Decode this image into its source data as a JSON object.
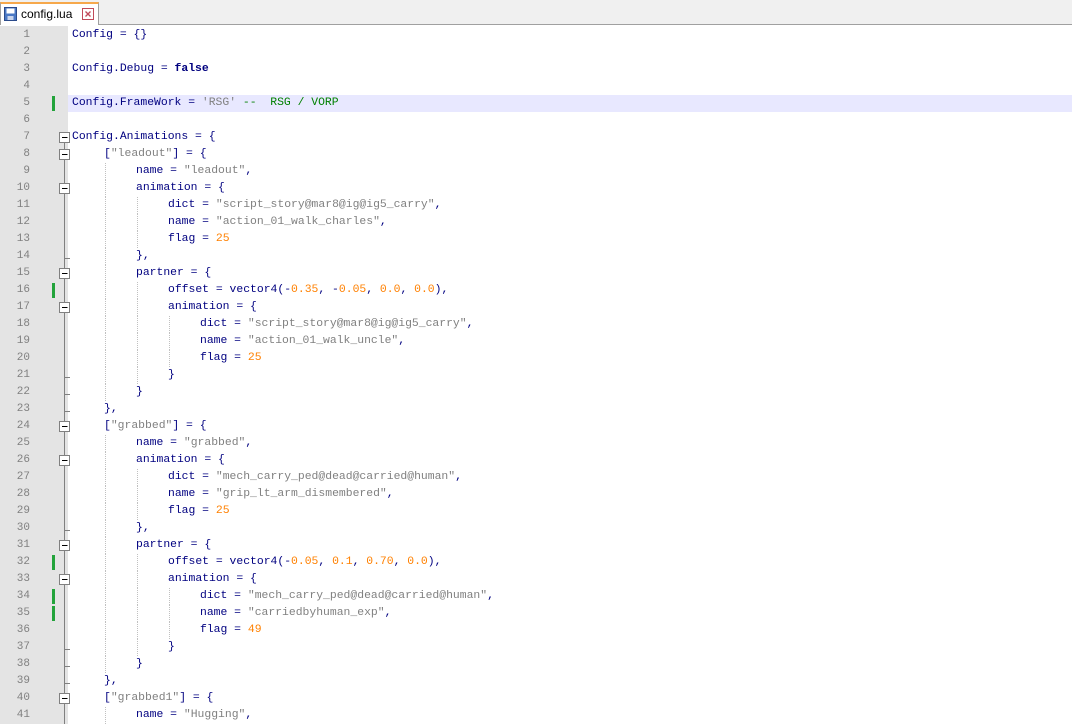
{
  "tab": {
    "filename": "config.lua",
    "icon": "save-file-icon",
    "close_icon": "close-icon"
  },
  "colors": {
    "string": "#808080",
    "number": "#ff8000",
    "keyword": "#00007f",
    "comment": "#008000",
    "default": "#000080",
    "change_bar": "#23a33b",
    "highlight": "#e8e8ff"
  },
  "highlighted_line": 5,
  "changed_lines": [
    5,
    16,
    32,
    34,
    35
  ],
  "lines": [
    {
      "n": "1",
      "indent": 0,
      "tokens": [
        [
          "op",
          "Config = {}"
        ]
      ]
    },
    {
      "n": "2",
      "indent": 0,
      "tokens": []
    },
    {
      "n": "3",
      "indent": 0,
      "tokens": [
        [
          "op",
          "Config.Debug = "
        ],
        [
          "kw",
          "false"
        ]
      ]
    },
    {
      "n": "4",
      "indent": 0,
      "tokens": []
    },
    {
      "n": "5",
      "indent": 0,
      "tokens": [
        [
          "op",
          "Config.FrameWork = "
        ],
        [
          "str",
          "'RSG'"
        ],
        [
          "op",
          " "
        ],
        [
          "cmt",
          "--  RSG / VORP"
        ]
      ]
    },
    {
      "n": "6",
      "indent": 0,
      "tokens": []
    },
    {
      "n": "7",
      "indent": 0,
      "fold": "open",
      "tokens": [
        [
          "op",
          "Config.Animations = {"
        ]
      ]
    },
    {
      "n": "8",
      "indent": 1,
      "fold": "open",
      "tokens": [
        [
          "op",
          "["
        ],
        [
          "str",
          "\"leadout\""
        ],
        [
          "op",
          "] = {"
        ]
      ]
    },
    {
      "n": "9",
      "indent": 2,
      "tokens": [
        [
          "op",
          "name = "
        ],
        [
          "str",
          "\"leadout\""
        ],
        [
          "op",
          ","
        ]
      ]
    },
    {
      "n": "10",
      "indent": 2,
      "fold": "open",
      "tokens": [
        [
          "op",
          "animation = {"
        ]
      ]
    },
    {
      "n": "11",
      "indent": 3,
      "tokens": [
        [
          "op",
          "dict = "
        ],
        [
          "str",
          "\"script_story@mar8@ig@ig5_carry\""
        ],
        [
          "op",
          ","
        ]
      ]
    },
    {
      "n": "12",
      "indent": 3,
      "tokens": [
        [
          "op",
          "name = "
        ],
        [
          "str",
          "\"action_01_walk_charles\""
        ],
        [
          "op",
          ","
        ]
      ]
    },
    {
      "n": "13",
      "indent": 3,
      "tokens": [
        [
          "op",
          "flag = "
        ],
        [
          "num",
          "25"
        ]
      ]
    },
    {
      "n": "14",
      "indent": 2,
      "fold": "end",
      "tokens": [
        [
          "op",
          "},"
        ]
      ]
    },
    {
      "n": "15",
      "indent": 2,
      "fold": "open",
      "tokens": [
        [
          "op",
          "partner = {"
        ]
      ]
    },
    {
      "n": "16",
      "indent": 3,
      "tokens": [
        [
          "op",
          "offset = vector4(-"
        ],
        [
          "num",
          "0.35"
        ],
        [
          "op",
          ", -"
        ],
        [
          "num",
          "0.05"
        ],
        [
          "op",
          ", "
        ],
        [
          "num",
          "0.0"
        ],
        [
          "op",
          ", "
        ],
        [
          "num",
          "0.0"
        ],
        [
          "op",
          "),"
        ]
      ]
    },
    {
      "n": "17",
      "indent": 3,
      "fold": "open",
      "tokens": [
        [
          "op",
          "animation = {"
        ]
      ]
    },
    {
      "n": "18",
      "indent": 4,
      "tokens": [
        [
          "op",
          "dict = "
        ],
        [
          "str",
          "\"script_story@mar8@ig@ig5_carry\""
        ],
        [
          "op",
          ","
        ]
      ]
    },
    {
      "n": "19",
      "indent": 4,
      "tokens": [
        [
          "op",
          "name = "
        ],
        [
          "str",
          "\"action_01_walk_uncle\""
        ],
        [
          "op",
          ","
        ]
      ]
    },
    {
      "n": "20",
      "indent": 4,
      "tokens": [
        [
          "op",
          "flag = "
        ],
        [
          "num",
          "25"
        ]
      ]
    },
    {
      "n": "21",
      "indent": 3,
      "fold": "end",
      "tokens": [
        [
          "op",
          "}"
        ]
      ]
    },
    {
      "n": "22",
      "indent": 2,
      "fold": "end",
      "tokens": [
        [
          "op",
          "}"
        ]
      ]
    },
    {
      "n": "23",
      "indent": 1,
      "fold": "end",
      "tokens": [
        [
          "op",
          "},"
        ]
      ]
    },
    {
      "n": "24",
      "indent": 1,
      "fold": "open",
      "tokens": [
        [
          "op",
          "["
        ],
        [
          "str",
          "\"grabbed\""
        ],
        [
          "op",
          "] = {"
        ]
      ]
    },
    {
      "n": "25",
      "indent": 2,
      "tokens": [
        [
          "op",
          "name = "
        ],
        [
          "str",
          "\"grabbed\""
        ],
        [
          "op",
          ","
        ]
      ]
    },
    {
      "n": "26",
      "indent": 2,
      "fold": "open",
      "tokens": [
        [
          "op",
          "animation = {"
        ]
      ]
    },
    {
      "n": "27",
      "indent": 3,
      "tokens": [
        [
          "op",
          "dict = "
        ],
        [
          "str",
          "\"mech_carry_ped@dead@carried@human\""
        ],
        [
          "op",
          ","
        ]
      ]
    },
    {
      "n": "28",
      "indent": 3,
      "tokens": [
        [
          "op",
          "name = "
        ],
        [
          "str",
          "\"grip_lt_arm_dismembered\""
        ],
        [
          "op",
          ","
        ]
      ]
    },
    {
      "n": "29",
      "indent": 3,
      "tokens": [
        [
          "op",
          "flag = "
        ],
        [
          "num",
          "25"
        ]
      ]
    },
    {
      "n": "30",
      "indent": 2,
      "fold": "end",
      "tokens": [
        [
          "op",
          "},"
        ]
      ]
    },
    {
      "n": "31",
      "indent": 2,
      "fold": "open",
      "tokens": [
        [
          "op",
          "partner = {"
        ]
      ]
    },
    {
      "n": "32",
      "indent": 3,
      "tokens": [
        [
          "op",
          "offset = vector4(-"
        ],
        [
          "num",
          "0.05"
        ],
        [
          "op",
          ", "
        ],
        [
          "num",
          "0.1"
        ],
        [
          "op",
          ", "
        ],
        [
          "num",
          "0.70"
        ],
        [
          "op",
          ", "
        ],
        [
          "num",
          "0.0"
        ],
        [
          "op",
          "),"
        ]
      ]
    },
    {
      "n": "33",
      "indent": 3,
      "fold": "open",
      "tokens": [
        [
          "op",
          "animation = {"
        ]
      ]
    },
    {
      "n": "34",
      "indent": 4,
      "tokens": [
        [
          "op",
          "dict = "
        ],
        [
          "str",
          "\"mech_carry_ped@dead@carried@human\""
        ],
        [
          "op",
          ","
        ]
      ]
    },
    {
      "n": "35",
      "indent": 4,
      "tokens": [
        [
          "op",
          "name = "
        ],
        [
          "str",
          "\"carriedbyhuman_exp\""
        ],
        [
          "op",
          ","
        ]
      ]
    },
    {
      "n": "36",
      "indent": 4,
      "tokens": [
        [
          "op",
          "flag = "
        ],
        [
          "num",
          "49"
        ]
      ]
    },
    {
      "n": "37",
      "indent": 3,
      "fold": "end",
      "tokens": [
        [
          "op",
          "}"
        ]
      ]
    },
    {
      "n": "38",
      "indent": 2,
      "fold": "end",
      "tokens": [
        [
          "op",
          "}"
        ]
      ]
    },
    {
      "n": "39",
      "indent": 1,
      "fold": "end",
      "tokens": [
        [
          "op",
          "},"
        ]
      ]
    },
    {
      "n": "40",
      "indent": 1,
      "fold": "open",
      "tokens": [
        [
          "op",
          "["
        ],
        [
          "str",
          "\"grabbed1\""
        ],
        [
          "op",
          "] = {"
        ]
      ]
    },
    {
      "n": "41",
      "indent": 2,
      "tokens": [
        [
          "op",
          "name = "
        ],
        [
          "str",
          "\"Hugging\""
        ],
        [
          "op",
          ","
        ]
      ]
    }
  ]
}
